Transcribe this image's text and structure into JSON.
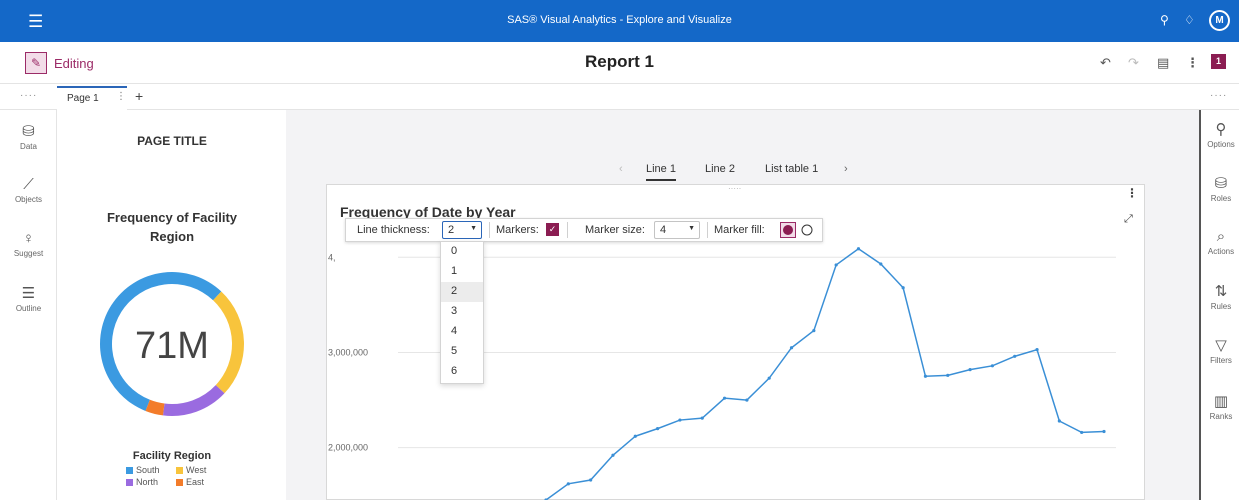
{
  "topbar": {
    "app_title": "SAS® Visual Analytics - Explore and Visualize",
    "menu_icon": "hamburger-menu-icon",
    "search_icon": "search-icon",
    "notifications_icon": "bell-icon",
    "avatar_initial": "M",
    "color": "#1468c8"
  },
  "editbar": {
    "mode_label": "Editing",
    "report_title": "Report 1",
    "badge_count": "1",
    "accent": "#9b2b67"
  },
  "pages": {
    "tabs": [
      "Page 1"
    ],
    "add_label": "+"
  },
  "left_rail": [
    {
      "label": "Data",
      "icon": "database-icon"
    },
    {
      "label": "Objects",
      "icon": "chart-icon"
    },
    {
      "label": "Suggest",
      "icon": "lightbulb-icon"
    },
    {
      "label": "Outline",
      "icon": "list-icon"
    }
  ],
  "right_rail": [
    {
      "label": "Options",
      "icon": "paintbrush-icon"
    },
    {
      "label": "Roles",
      "icon": "roles-icon"
    },
    {
      "label": "Actions",
      "icon": "actions-icon"
    },
    {
      "label": "Rules",
      "icon": "rules-icon"
    },
    {
      "label": "Filters",
      "icon": "filter-icon"
    },
    {
      "label": "Ranks",
      "icon": "ranks-icon"
    }
  ],
  "left_panel": {
    "page_title": "PAGE TITLE",
    "donut": {
      "title_line1": "Frequency of Facility",
      "title_line2": "Region",
      "center_value": "71M",
      "legend_title": "Facility Region",
      "segments": [
        {
          "name": "South",
          "fraction": 0.56,
          "color": "#3b9ae1"
        },
        {
          "name": "West",
          "fraction": 0.25,
          "color": "#f8c43c"
        },
        {
          "name": "North",
          "fraction": 0.15,
          "color": "#9a6be0"
        },
        {
          "name": "East",
          "fraction": 0.04,
          "color": "#f37c2a"
        }
      ]
    }
  },
  "object_tabs": {
    "items": [
      "Line 1",
      "Line 2",
      "List table 1"
    ],
    "active": "Line 1",
    "prev": "‹",
    "next": "›"
  },
  "toolbar": {
    "line_thickness_label": "Line thickness:",
    "line_thickness_value": "2",
    "markers_label": "Markers:",
    "marker_size_label": "Marker size:",
    "marker_size_value": "4",
    "marker_fill_label": "Marker fill:"
  },
  "dropdown_options": [
    "0",
    "1",
    "2",
    "3",
    "4",
    "5",
    "6"
  ],
  "dropdown_selected": "2",
  "chart_data": {
    "type": "line",
    "title": "Frequency of Date by Year",
    "visible_y_tick_labels": [
      "2,000,000",
      "3,000,000"
    ],
    "partially_visible_tick_label": "4,",
    "series_color": "#3a8fd6",
    "grid": true,
    "y_range_visible": [
      1450000,
      4350000
    ],
    "y": [
      1450000,
      1620000,
      1660000,
      1920000,
      2120000,
      2200000,
      2290000,
      2310000,
      2520000,
      2500000,
      2730000,
      3050000,
      3230000,
      3920000,
      4090000,
      3930000,
      3680000,
      2750000,
      2760000,
      2820000,
      2860000,
      2960000,
      3030000,
      2280000,
      2160000,
      2170000
    ]
  }
}
